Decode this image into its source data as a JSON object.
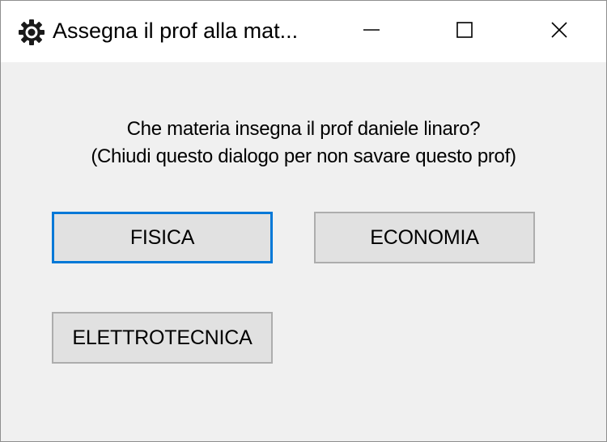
{
  "window": {
    "title": "Assegna il prof alla mat...",
    "icon": "gear-icon"
  },
  "caption_buttons": {
    "minimize": "minimize-icon",
    "maximize": "maximize-icon",
    "close": "close-icon"
  },
  "dialog": {
    "question": "Che materia insegna il prof daniele linaro?",
    "hint": "(Chiudi questo dialogo per non savare questo prof)"
  },
  "subjects": [
    {
      "label": "FISICA",
      "focused": true
    },
    {
      "label": "ECONOMIA",
      "focused": false
    },
    {
      "label": "ELETTROTECNICA",
      "focused": false
    }
  ],
  "colors": {
    "focus_border": "#0078d7",
    "button_face": "#e1e1e1",
    "dialog_background": "#f0f0f0"
  }
}
